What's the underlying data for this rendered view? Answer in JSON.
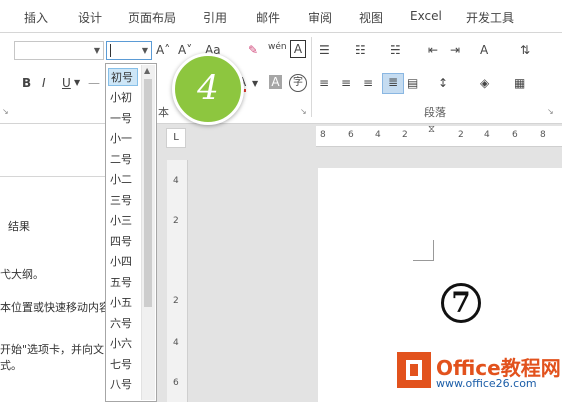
{
  "tabs": [
    "插入",
    "设计",
    "页面布局",
    "引用",
    "邮件",
    "审阅",
    "视图",
    "Excel",
    "开发工具"
  ],
  "ribbon": {
    "font_name_value": "",
    "font_size_value": "",
    "format_buttons": [
      "B",
      "I",
      "U"
    ],
    "grow_font": "A˄",
    "shrink_font": "A˅",
    "change_case": "Aa",
    "phonetic": "wén",
    "char_border": "A",
    "font_color": "A",
    "char_shading": "A",
    "enclose_char": "字",
    "font_group_label": "本",
    "paragraph_group_label": "段落"
  },
  "step_badge": "4",
  "font_sizes": [
    "初号",
    "小初",
    "一号",
    "小一",
    "二号",
    "小二",
    "三号",
    "小三",
    "四号",
    "小四",
    "五号",
    "小五",
    "六号",
    "小六",
    "七号",
    "八号"
  ],
  "left_pane": {
    "result_label": "结果",
    "line1": "弋大纲。",
    "line2": "本位置或快速移动内容",
    "line3": "开始\"选项卡，并向文",
    "line4": "式。"
  },
  "hruler": [
    "8",
    "6",
    "4",
    "2",
    "2",
    "4",
    "6",
    "8"
  ],
  "vruler": [
    "4",
    "2",
    "2",
    "4",
    "6"
  ],
  "tab_selector": "L",
  "circled_number": "⑦",
  "logo": {
    "title": "Office教程网",
    "url": "www.office26.com"
  },
  "colors": {
    "accent_green": "#8dc63f",
    "logo_orange": "#e2521d",
    "font_color_underline": "#e03c31"
  }
}
